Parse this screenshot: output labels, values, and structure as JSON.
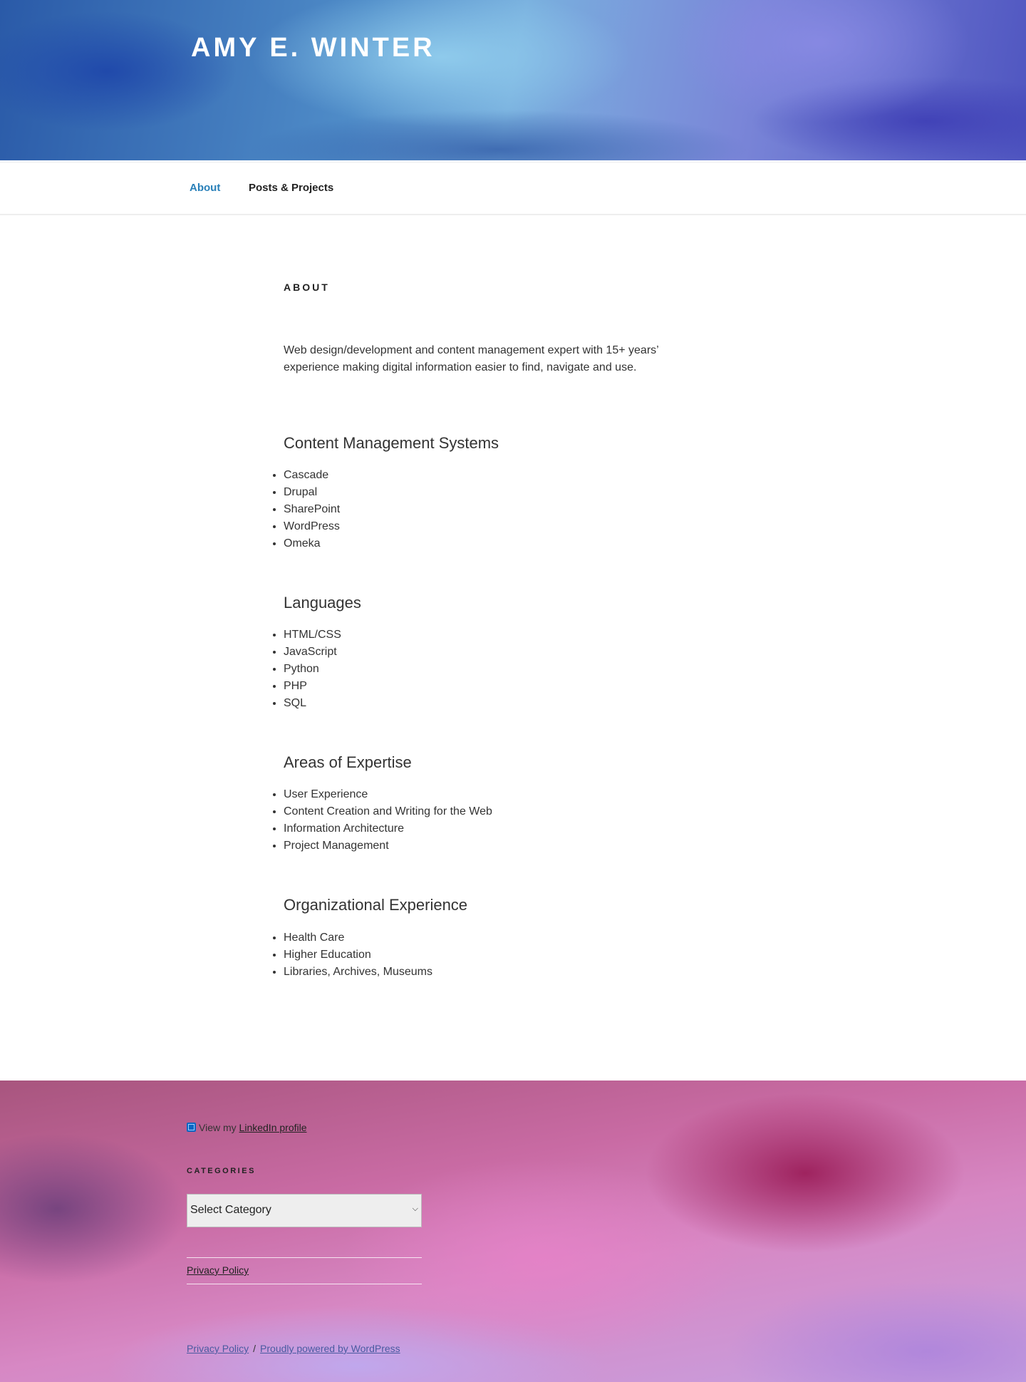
{
  "site": {
    "title": "AMY E. WINTER"
  },
  "nav": {
    "items": [
      {
        "label": "About",
        "active": true
      },
      {
        "label": "Posts & Projects",
        "active": false
      }
    ]
  },
  "page": {
    "title": "ABOUT",
    "intro": "Web design/development and content management expert with 15+ years’ experience making digital information easier to find, navigate and use.",
    "sections": [
      {
        "heading": "Content Management Systems",
        "items": [
          "Cascade",
          "Drupal",
          "SharePoint",
          "WordPress",
          "Omeka"
        ]
      },
      {
        "heading": "Languages",
        "items": [
          "HTML/CSS",
          "JavaScript",
          "Python",
          "PHP",
          "SQL"
        ]
      },
      {
        "heading": "Areas of Expertise",
        "items": [
          "User Experience",
          "Content Creation and Writing for the Web",
          "Information Architecture",
          "Project Management"
        ]
      },
      {
        "heading": "Organizational Experience",
        "items": [
          "Health Care",
          "Higher Education",
          "Libraries, Archives, Museums"
        ]
      }
    ]
  },
  "footer": {
    "linkedin_prefix": "View my",
    "linkedin_link": "LinkedIn profile",
    "linkedin_icon": "linkedin-icon",
    "categories_heading": "CATEGORIES",
    "categories_select": "Select Category",
    "menu_link": "Privacy Policy",
    "bottom_privacy": "Privacy Policy",
    "bottom_separator": "/",
    "bottom_powered": "Proudly powered by WordPress"
  },
  "colors": {
    "nav_active": "#2980b9",
    "linkedin": "#0a66c2"
  }
}
